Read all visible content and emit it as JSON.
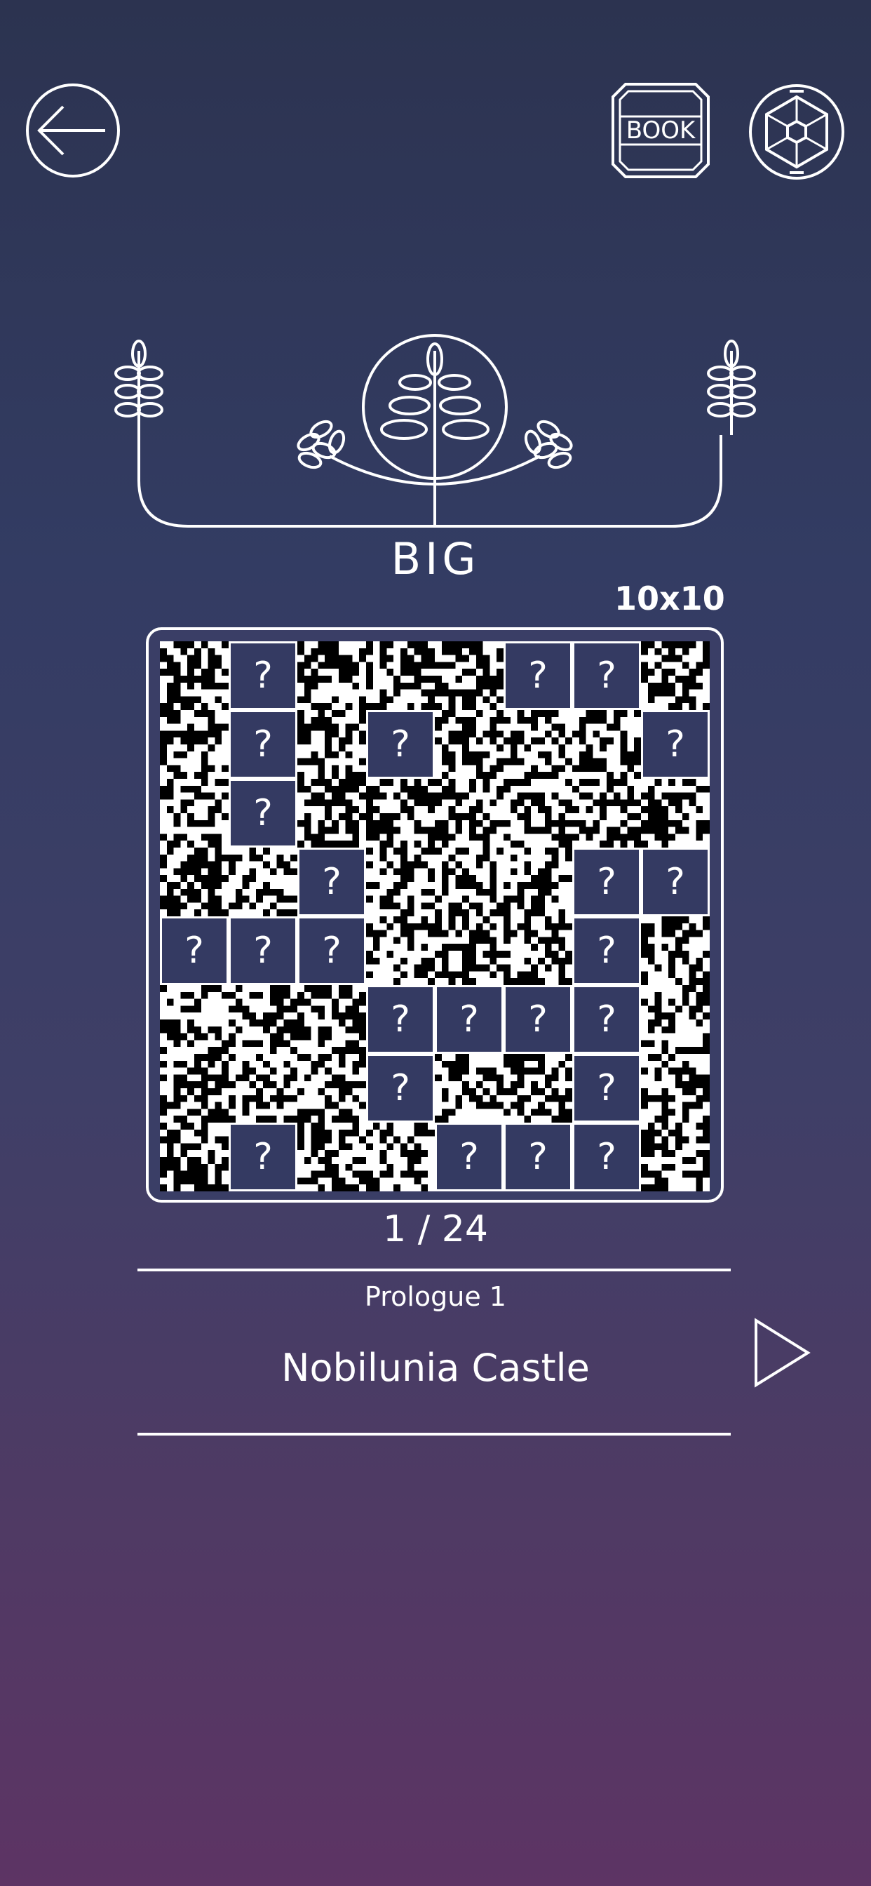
{
  "header": {
    "back_icon": "arrow-left-icon",
    "book_label": "BOOK",
    "settings_icon": "hexagon-gear-icon"
  },
  "emblem": {
    "icon": "wheat-laurel-emblem-icon"
  },
  "puzzle": {
    "size_title": "BIG",
    "grid_size": "10x10",
    "rows": 8,
    "cols": 8,
    "locked_label": "?",
    "tiles": [
      [
        0,
        1,
        0,
        0,
        0,
        1,
        1,
        0
      ],
      [
        0,
        1,
        0,
        1,
        0,
        0,
        0,
        1
      ],
      [
        0,
        1,
        0,
        0,
        0,
        0,
        0,
        0
      ],
      [
        0,
        0,
        1,
        0,
        0,
        0,
        1,
        1
      ],
      [
        1,
        1,
        1,
        0,
        0,
        0,
        1,
        0
      ],
      [
        0,
        0,
        0,
        1,
        1,
        1,
        1,
        0
      ],
      [
        0,
        0,
        0,
        1,
        0,
        0,
        1,
        0
      ],
      [
        0,
        1,
        0,
        0,
        1,
        1,
        1,
        0
      ]
    ]
  },
  "progress": {
    "count": "1 / 24"
  },
  "stage": {
    "chapter": "Prologue 1",
    "name": "Nobilunia Castle",
    "play_icon": "play-triangle-icon"
  }
}
